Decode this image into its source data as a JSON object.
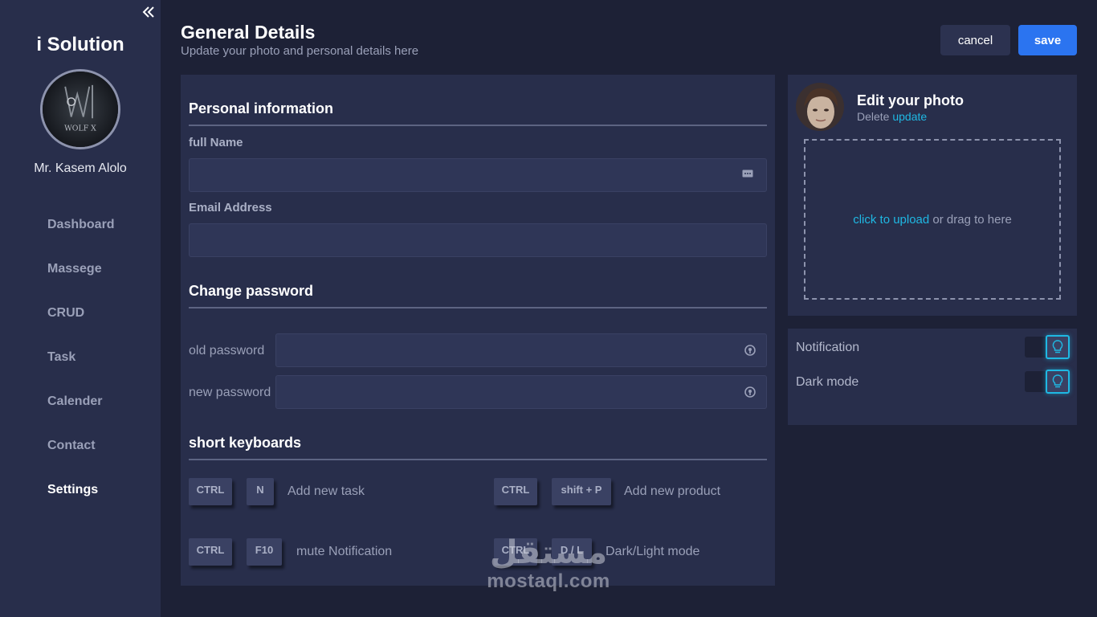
{
  "sidebar": {
    "brand": "i Solution",
    "user_name": "Mr. Kasem Alolo",
    "avatar_text": "WOLF X",
    "items": [
      {
        "label": "Dashboard"
      },
      {
        "label": "Massege"
      },
      {
        "label": "CRUD"
      },
      {
        "label": "Task"
      },
      {
        "label": "Calender"
      },
      {
        "label": "Contact"
      },
      {
        "label": "Settings"
      }
    ],
    "active_item": "Settings"
  },
  "header": {
    "title": "General Details",
    "subtitle": "Update your photo and personal details here",
    "cancel_label": "cancel",
    "save_label": "save"
  },
  "personal": {
    "title": "Personal information",
    "full_name_label": "full Name",
    "full_name_value": "",
    "email_label": "Email Address",
    "email_value": ""
  },
  "password": {
    "title": "Change password",
    "old_label": "old password",
    "old_value": "",
    "new_label": "new password",
    "new_value": ""
  },
  "shortcuts": {
    "title": "short keyboards",
    "items": [
      {
        "key1": "CTRL",
        "key2": "N",
        "desc": "Add new task"
      },
      {
        "key1": "CTRL",
        "key2": "shift + P",
        "desc": "Add new product"
      },
      {
        "key1": "CTRL",
        "key2": "F10",
        "desc": "mute Notification"
      },
      {
        "key1": "CTRL",
        "key2": "D / L",
        "desc": "Dark/Light mode"
      }
    ]
  },
  "photo": {
    "title": "Edit your photo",
    "delete_label": "Delete",
    "update_label": "update",
    "upload_link": "click to upload",
    "upload_rest": " or drag to here"
  },
  "settings": {
    "notification_label": "Notification",
    "dark_mode_label": "Dark mode"
  },
  "watermark": {
    "arabic": "مستقل",
    "latin": "mostaql.com"
  },
  "colors": {
    "background": "#1d2136",
    "panel": "#282e4b",
    "accent": "#2b74f0",
    "link": "#1fb8e3"
  }
}
